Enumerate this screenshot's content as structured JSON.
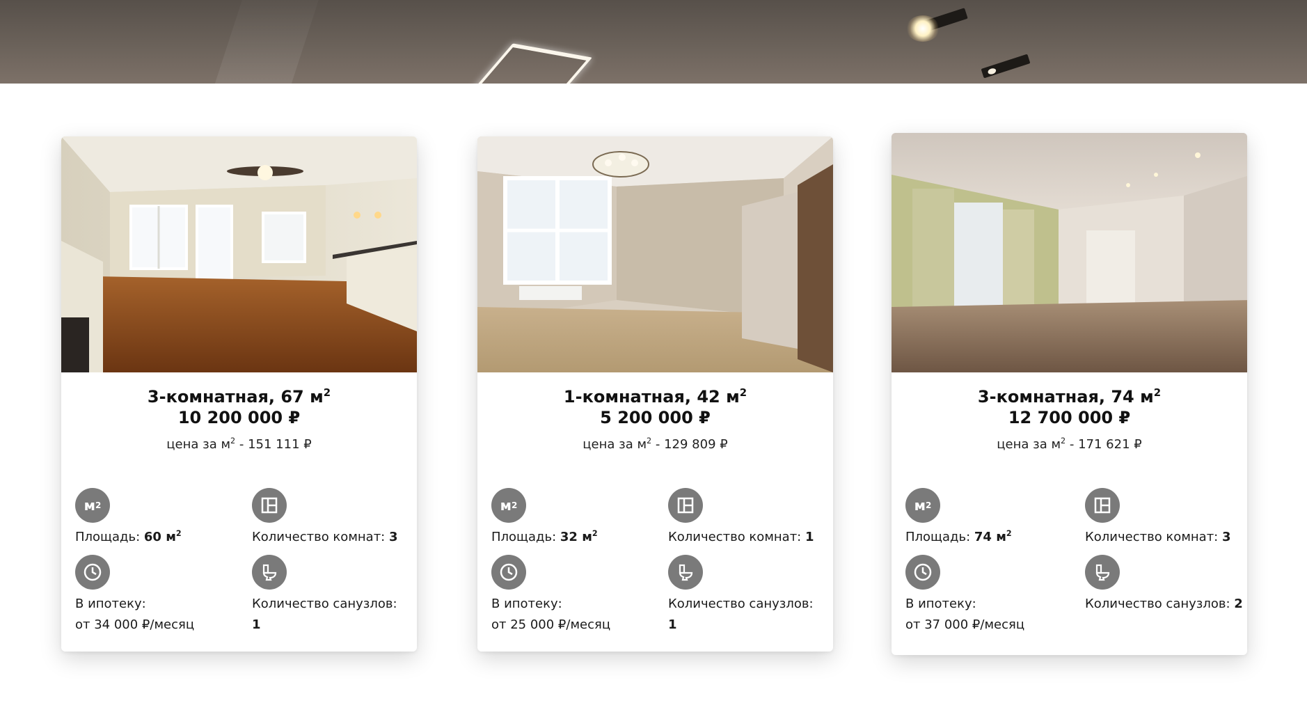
{
  "cards": [
    {
      "title": "3-комнатная, 67 м",
      "title_sup": "2",
      "price": "10 200 000 ₽",
      "price_per_m_label": "цена за м",
      "price_per_m_sup": "2",
      "price_per_m_value": " - 151 111 ₽",
      "area_icon": "м",
      "area_icon_sup": "2",
      "area_label": "Площадь: ",
      "area_value": "60 м",
      "area_sup": "2",
      "rooms_label": "Количество комнат: ",
      "rooms_value": "3",
      "mortgage_label": "В ипотеку:",
      "mortgage_value": "от 34 000 ₽/месяц",
      "bathrooms_label": "Количество санузлов: ",
      "bathrooms_value": "1"
    },
    {
      "title": "1-комнатная, 42 м",
      "title_sup": "2",
      "price": "5 200 000 ₽",
      "price_per_m_label": "цена за м",
      "price_per_m_sup": "2",
      "price_per_m_value": " - 129 809 ₽",
      "area_icon": "м",
      "area_icon_sup": "2",
      "area_label": "Площадь: ",
      "area_value": "32 м",
      "area_sup": "2",
      "rooms_label": "Количество комнат: ",
      "rooms_value": "1",
      "mortgage_label": "В ипотеку:",
      "mortgage_value": "от 25 000 ₽/месяц",
      "bathrooms_label": "Количество санузлов: ",
      "bathrooms_value": "1"
    },
    {
      "title": "3-комнатная, 74 м",
      "title_sup": "2",
      "price": "12 700 000 ₽",
      "price_per_m_label": "цена за м",
      "price_per_m_sup": "2",
      "price_per_m_value": " - 171 621 ₽",
      "area_icon": "м",
      "area_icon_sup": "2",
      "area_label": "Площадь: ",
      "area_value": "74 м",
      "area_sup": "2",
      "rooms_label": "Количество комнат: ",
      "rooms_value": "3",
      "mortgage_label": "В ипотеку:",
      "mortgage_value": "от 37 000 ₽/месяц",
      "bathrooms_label": "Количество санузлов: ",
      "bathrooms_value": "2"
    }
  ],
  "icons": {
    "area": "area-icon",
    "rooms": "floor-plan-icon",
    "mortgage": "clock-icon",
    "bathrooms": "toilet-icon"
  },
  "colors": {
    "icon_bg": "#7a7a7a",
    "text": "#111111"
  }
}
